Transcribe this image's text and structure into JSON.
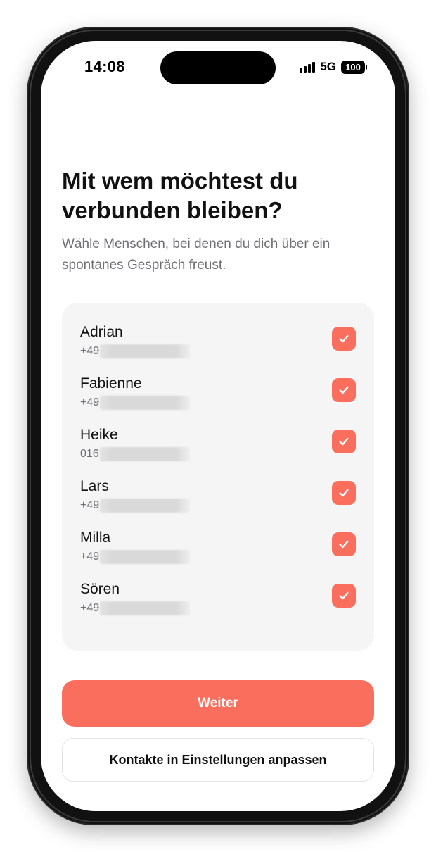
{
  "status_bar": {
    "time": "14:08",
    "network": "5G",
    "battery": "100"
  },
  "header": {
    "title": "Mit wem möchtest du verbunden bleiben?",
    "subtitle": "Wähle Menschen, bei denen du dich über ein spontanes Gespräch freust."
  },
  "contacts": [
    {
      "name": "Adrian",
      "phone_visible": "+49",
      "checked": true
    },
    {
      "name": "Fabienne",
      "phone_visible": "+49",
      "checked": true
    },
    {
      "name": "Heike",
      "phone_visible": "016",
      "checked": true
    },
    {
      "name": "Lars",
      "phone_visible": "+49",
      "checked": true
    },
    {
      "name": "Milla",
      "phone_visible": "+49",
      "checked": true
    },
    {
      "name": "Sören",
      "phone_visible": "+49",
      "checked": true
    }
  ],
  "actions": {
    "primary_label": "Weiter",
    "secondary_label": "Kontakte in Einstellungen anpassen"
  },
  "colors": {
    "accent": "#fa6e5e",
    "card_background": "#f5f5f5",
    "secondary_text": "#6e6e73"
  },
  "icons": {
    "checkbox": "checkmark-icon",
    "signal": "cellular-signal-icon",
    "battery": "battery-icon"
  }
}
